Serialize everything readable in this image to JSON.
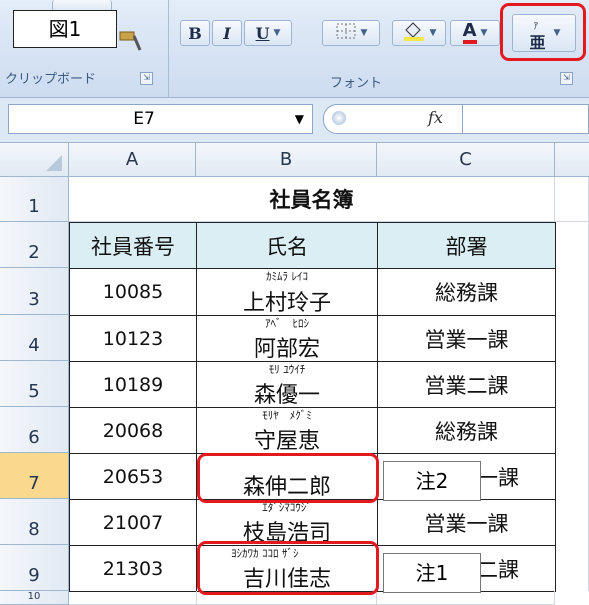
{
  "figure_label": "図1",
  "ribbon": {
    "clipboard_group": "クリップボード",
    "font_group": "フォント",
    "bold": "B",
    "italic": "I",
    "underline": "U",
    "font_color_letter": "A",
    "furigana_top": "ｱ",
    "furigana_main": "亜",
    "launcher_glyph": "⇲"
  },
  "formula_bar": {
    "name_box": "E7",
    "fx": "fx",
    "formula": ""
  },
  "columns": [
    "A",
    "B",
    "C"
  ],
  "rows": [
    "1",
    "2",
    "3",
    "4",
    "5",
    "6",
    "7",
    "8",
    "9",
    "10"
  ],
  "title": "社員名簿",
  "headers": [
    "社員番号",
    "氏名",
    "部署"
  ],
  "records": [
    {
      "id": "10085",
      "furigana": "ｶﾐﾑﾗ ﾚｲｺ",
      "name": "上村玲子",
      "dept": "総務課"
    },
    {
      "id": "10123",
      "furigana": "ｱﾍﾞ　ﾋﾛｼ",
      "name": "阿部宏",
      "dept": "営業一課"
    },
    {
      "id": "10189",
      "furigana": "ﾓﾘ ﾕｳｲﾁ",
      "name": "森優一",
      "dept": "営業二課"
    },
    {
      "id": "20068",
      "furigana": "ﾓﾘﾔ　ﾒｸﾞﾐ",
      "name": "守屋恵",
      "dept": "総務課"
    },
    {
      "id": "20653",
      "furigana": "",
      "name": "森伸二郎",
      "dept": "一課"
    },
    {
      "id": "21007",
      "furigana": "ｴﾀﾞｼﾏｺｳｼﾞ",
      "name": "枝島浩司",
      "dept": "営業一課"
    },
    {
      "id": "21303",
      "furigana": "ﾖｼｶﾜｶ ｺｺﾛ ｻﾞｼ",
      "name": "吉川佳志",
      "dept": "二課"
    }
  ],
  "notes": {
    "note1": "注1",
    "note2": "注2"
  },
  "colors": {
    "callout": "#e2191f",
    "header_fill": "#daeef3",
    "selected_row": "#f8d98e"
  }
}
